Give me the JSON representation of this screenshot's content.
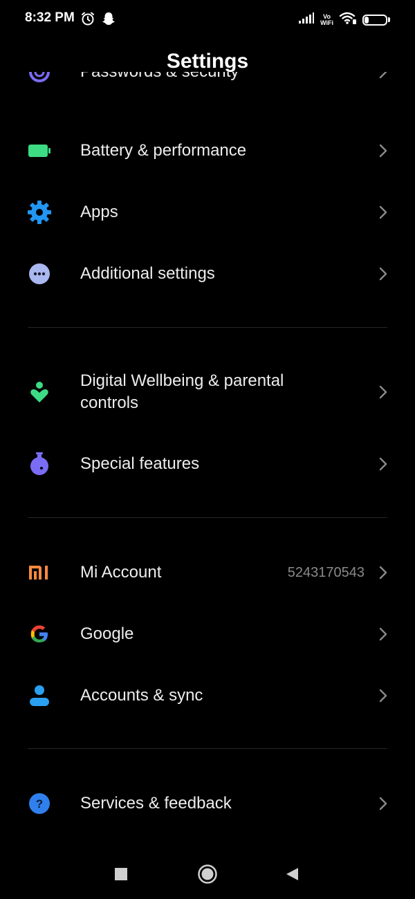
{
  "status_bar": {
    "time": "8:32 PM",
    "vowifi_line1": "Vo",
    "vowifi_line2": "WiFi",
    "battery_level": "19",
    "battery_fraction": 0.19
  },
  "header": {
    "title": "Settings"
  },
  "settings": {
    "passwords": {
      "label": "Passwords & security"
    },
    "battery": {
      "label": "Battery & performance"
    },
    "apps": {
      "label": "Apps"
    },
    "additional": {
      "label": "Additional settings"
    },
    "wellbeing": {
      "label": "Digital Wellbeing & parental controls"
    },
    "special": {
      "label": "Special features"
    },
    "mi_account": {
      "label": "Mi Account",
      "value": "5243170543"
    },
    "google": {
      "label": "Google"
    },
    "accounts_sync": {
      "label": "Accounts & sync"
    },
    "services": {
      "label": "Services & feedback"
    }
  },
  "colors": {
    "background": "#000000",
    "text": "#ededed",
    "secondary_text": "#8a8a8a",
    "divider": "#262626",
    "battery_icon": "#3ddc84",
    "apps_icon": "#2196f3",
    "additional_icon": "#a9b8f0",
    "wellbeing_icon": "#3ddc84",
    "special_icon": "#7b6cf6",
    "mi_icon": "#ff8a3d",
    "accounts_icon": "#2ba0f0",
    "services_icon": "#2f80ed",
    "passwords_icon": "#7b6cf6"
  },
  "icons": {
    "passwords": "shield-icon",
    "battery": "battery-icon",
    "apps": "gear-icon",
    "additional": "more-dots-icon",
    "wellbeing": "wellbeing-heart-icon",
    "special": "flask-icon",
    "mi_account": "mi-logo-icon",
    "google": "google-logo-icon",
    "accounts_sync": "person-icon",
    "services": "help-icon",
    "chevron": "chevron-right-icon"
  }
}
